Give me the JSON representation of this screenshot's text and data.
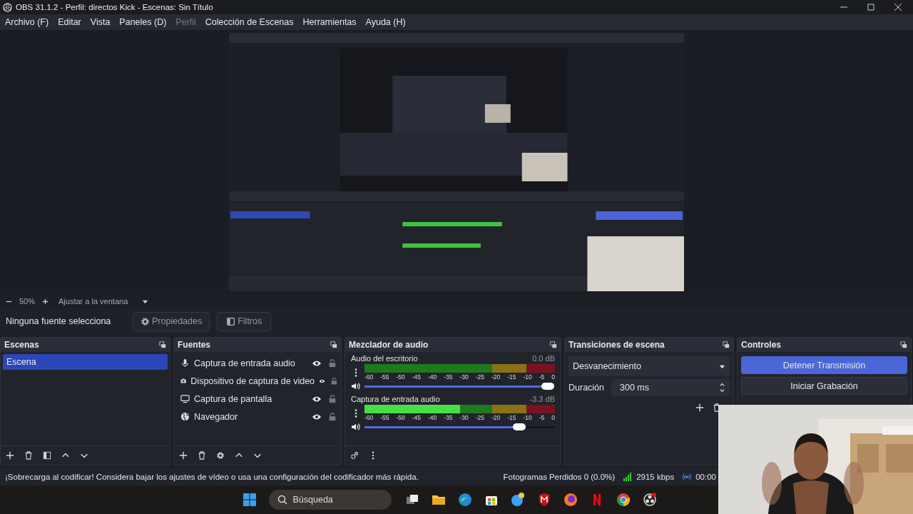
{
  "window": {
    "title": "OBS 31.1.2 - Perfil: directos Kick - Escenas: Sin Título"
  },
  "menu": [
    {
      "label": "Archivo (F)",
      "disabled": false
    },
    {
      "label": "Editar",
      "disabled": false
    },
    {
      "label": "Vista",
      "disabled": false
    },
    {
      "label": "Paneles (D)",
      "disabled": false
    },
    {
      "label": "Perfil",
      "disabled": true
    },
    {
      "label": "Colección de Escenas",
      "disabled": false
    },
    {
      "label": "Herramientas",
      "disabled": false
    },
    {
      "label": "Ayuda (H)",
      "disabled": false
    }
  ],
  "preview": {
    "zoom": "50%",
    "fit": "Ajustar a la ventana"
  },
  "source_toolbar": {
    "label": "Ninguna fuente selecciona",
    "properties": "Propiedades",
    "filters": "Filtros"
  },
  "scenes": {
    "title": "Escenas",
    "items": [
      {
        "label": "Escena",
        "selected": true
      }
    ]
  },
  "sources": {
    "title": "Fuentes",
    "items": [
      {
        "kind": "mic",
        "label": "Captura de entrada audio"
      },
      {
        "kind": "camera",
        "label": "Dispositivo de captura de video"
      },
      {
        "kind": "monitor",
        "label": "Captura de pantalla"
      },
      {
        "kind": "globe",
        "label": "Navegador"
      }
    ]
  },
  "mixer": {
    "title": "Mezclador de audio",
    "channels": [
      {
        "name": "Audio del escritorio",
        "reading": "0.0 dB",
        "fader": {
          "level": 0.97
        },
        "scale": [
          "-60",
          "-55",
          "-50",
          "-45",
          "-40",
          "-35",
          "-30",
          "-25",
          "-20",
          "-15",
          "-10",
          "-5",
          "0"
        ]
      },
      {
        "name": "Captura de entrada audio",
        "reading": "-3.3 dB",
        "meter": {
          "level": 0.5
        },
        "fader": {
          "level": 0.82
        },
        "scale": [
          "-60",
          "-55",
          "-50",
          "-45",
          "-40",
          "-35",
          "-30",
          "-25",
          "-20",
          "-15",
          "-10",
          "-5",
          "0"
        ]
      }
    ]
  },
  "transitions": {
    "title": "Transiciones de escena",
    "transition": "Desvanecimiento",
    "duration_label": "Duración",
    "duration": "300 ms"
  },
  "controls": {
    "title": "Controles",
    "buttons": [
      {
        "label": "Detener Transmisión",
        "active": true
      },
      {
        "label": "Iniciar Grabación",
        "active": false
      }
    ]
  },
  "status_bar": {
    "message": "¡Sobrecarga al codificar! Considera bajar los ajustes de vídeo o usa una configuración del codificador más rápida.",
    "dropped": "Fotogramas Perdidos 0 (0.0%)",
    "bitrate": "2915 kbps",
    "time": "00:00"
  },
  "taskbar": {
    "search_placeholder": "Búsqueda"
  }
}
